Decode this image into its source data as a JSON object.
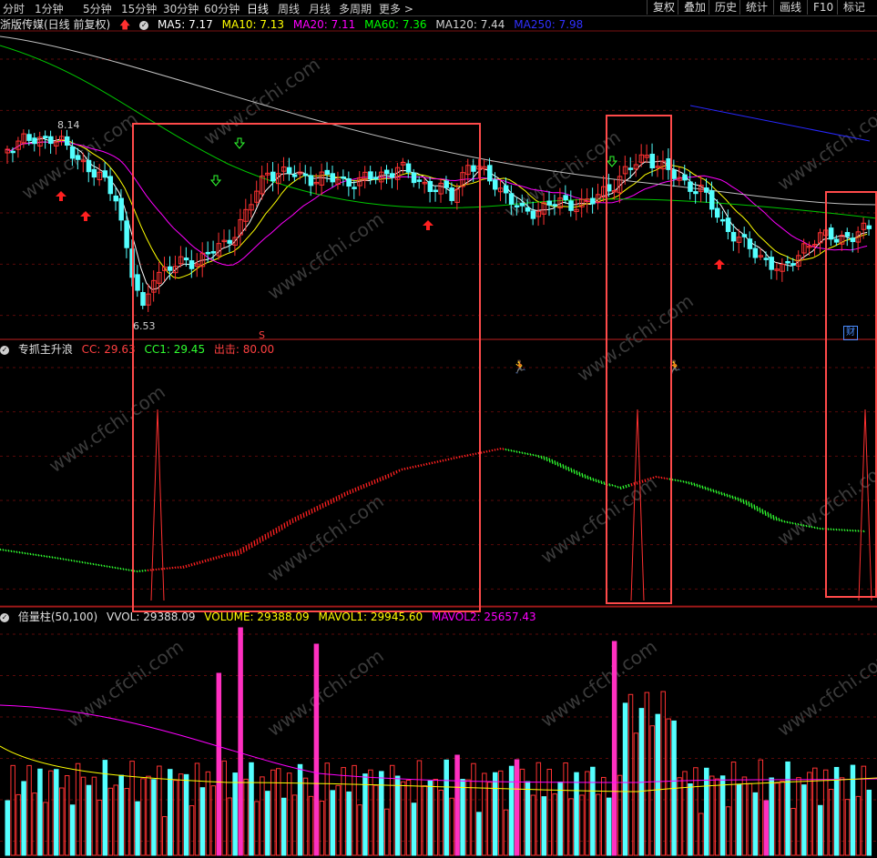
{
  "periods": [
    "分时",
    "1分钟",
    "5分钟",
    "15分钟",
    "30分钟",
    "60分钟",
    "日线",
    "周线",
    "月线",
    "多周期",
    "更多 >"
  ],
  "active_period": "日线",
  "toolbar_right": [
    "复权",
    "叠加",
    "历史",
    "统计",
    "画线",
    "F10",
    "标记"
  ],
  "price_panel": {
    "title": "浙版传媒(日线 前复权)",
    "ma": [
      {
        "label": "MA5: 7.17",
        "color": "#ffffff"
      },
      {
        "label": "MA10: 7.13",
        "color": "#ffff00"
      },
      {
        "label": "MA20: 7.11",
        "color": "#ff00ff"
      },
      {
        "label": "MA60: 7.36",
        "color": "#00ff00"
      },
      {
        "label": "MA120: 7.44",
        "color": "#d0d0d0"
      },
      {
        "label": "MA250: 7.98",
        "color": "#3030ff"
      }
    ],
    "high_label": "8.14",
    "low_label": "6.53",
    "cai_badge": "财",
    "s_marker": "S"
  },
  "indicator_panel": {
    "title": "专抓主升浪",
    "cc": "CC: 29.63",
    "cc1": "CC1: 29.45",
    "chuji": "出击: 80.00"
  },
  "volume_panel": {
    "title": "倍量柱(50,100)",
    "vvol": "VVOL: 29388.09",
    "volume": "VOLUME: 29388.09",
    "mavol1": "MAVOL1: 29945.60",
    "mavol2": "MAVOL2: 25657.43"
  },
  "watermark": "www.cfchi.com",
  "colors": {
    "up": "#ff3232",
    "down": "#54ffff",
    "box": "#ff4a4a",
    "ma5": "#ffffff",
    "ma10": "#ffff00",
    "ma20": "#ff00ff",
    "ma60": "#00c800",
    "ma120": "#c0c0c0",
    "ma250": "#2828ff"
  }
}
